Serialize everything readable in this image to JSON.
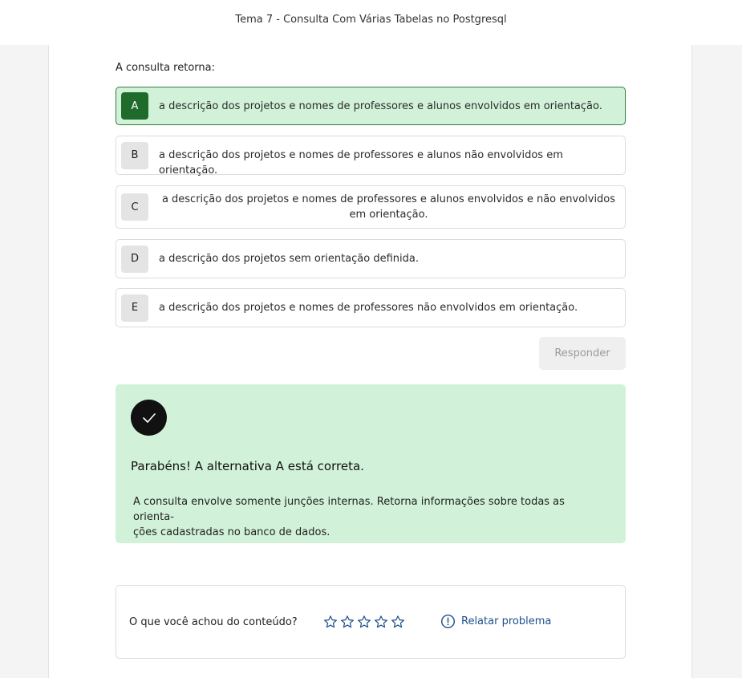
{
  "header": {
    "title": "Tema 7 - Consulta Com Várias Tabelas no Postgresql"
  },
  "question": {
    "prompt": "A consulta retorna:"
  },
  "options": [
    {
      "letter": "A",
      "text": "a descrição dos projetos e nomes de professores e alunos envolvidos em orientação."
    },
    {
      "letter": "B",
      "text": "a descrição dos projetos e nomes de professores e alunos não envolvidos em orientação."
    },
    {
      "letter": "C",
      "text": "a descrição dos projetos e nomes de professores e alunos envolvidos e não envolvidos em orientação."
    },
    {
      "letter": "D",
      "text": "a descrição dos projetos sem orientação definida."
    },
    {
      "letter": "E",
      "text": "a descrição dos projetos e nomes de professores não envolvidos em orientação."
    }
  ],
  "selected_option": "A",
  "respond_button": {
    "label": "Responder"
  },
  "feedback": {
    "icon": "check-icon",
    "title": "Parabéns! A alternativa A está correta.",
    "text_line1": "A consulta envolve somente junções internas. Retorna informações sobre todas as orienta-",
    "text_line2": "ções cadastradas no banco de dados."
  },
  "rating": {
    "label": "O que você achou do conteúdo?",
    "stars": 5,
    "report_label": "Relatar problema",
    "report_icon": "alert-circle-icon"
  },
  "colors": {
    "correct_bg": "#d1f2d9",
    "correct_letter_bg": "#1e6b2c",
    "star_color": "#1d4f8c",
    "link_color": "#1d4f8c"
  }
}
